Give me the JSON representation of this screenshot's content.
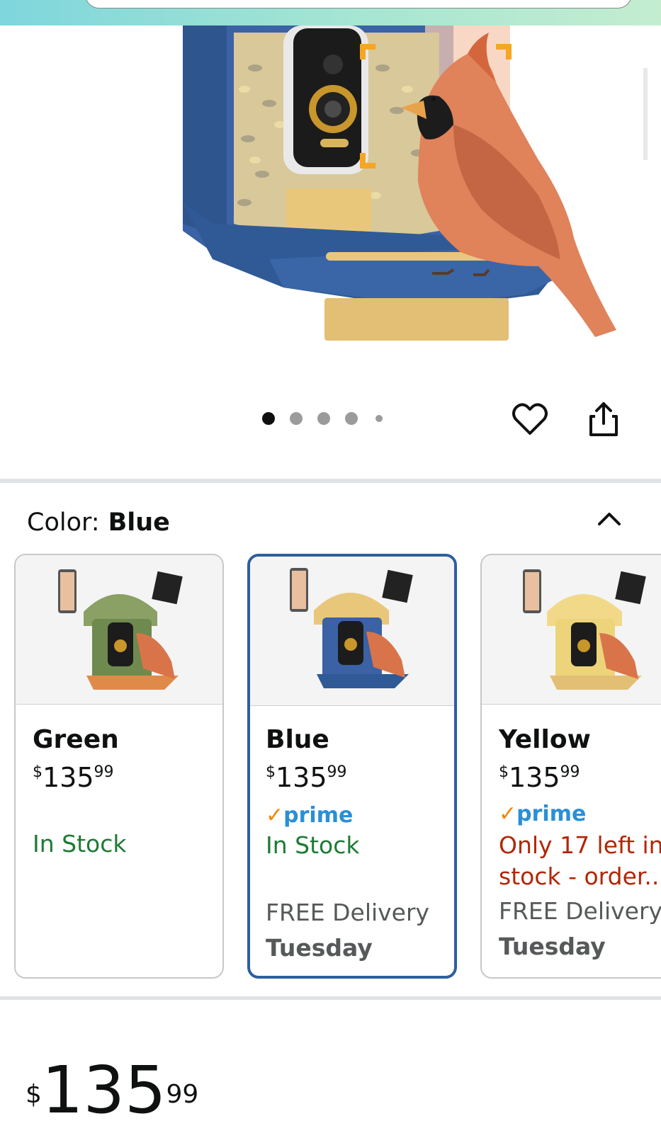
{
  "gallery": {
    "dot_count": 5,
    "active_dot": 0
  },
  "color_selector": {
    "label": "Color:",
    "selected": "Blue",
    "options": [
      {
        "name": "Green",
        "currency": "$",
        "price_whole": "135",
        "price_cents": "99",
        "prime": "",
        "stock": "In Stock",
        "delivery_line1": "",
        "delivery_line2": ""
      },
      {
        "name": "Blue",
        "currency": "$",
        "price_whole": "135",
        "price_cents": "99",
        "prime": "prime",
        "stock": "In Stock",
        "delivery_line1": "FREE Delivery",
        "delivery_line2": "Tuesday"
      },
      {
        "name": "Yellow",
        "currency": "$",
        "price_whole": "135",
        "price_cents": "99",
        "prime": "prime",
        "stock_line1": "Only 17 left in",
        "stock_line2": "stock - order...",
        "delivery_line1": "FREE Delivery",
        "delivery_line2": "Tuesday"
      }
    ]
  },
  "price": {
    "currency": "$",
    "whole": "135",
    "cents": "99"
  },
  "colors": {
    "accent": "#2d5f9e",
    "in_stock": "#1e7b34",
    "low_stock": "#b12704",
    "prime": "#2a8fd6"
  }
}
